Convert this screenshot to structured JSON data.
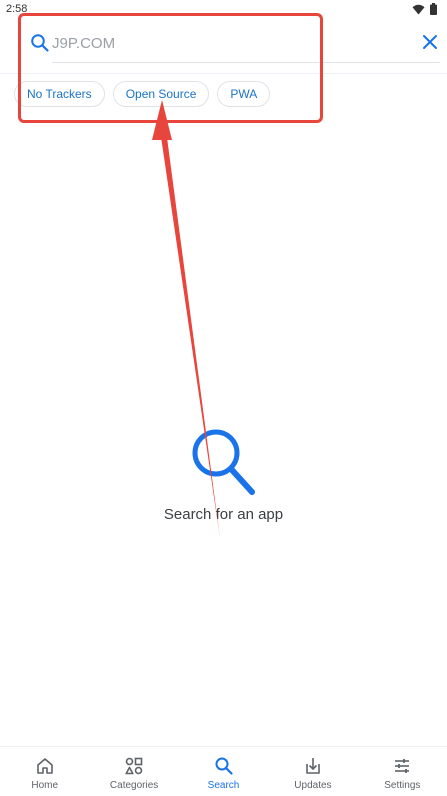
{
  "status_bar": {
    "time": "2:58",
    "icons": [
      "wifi-icon",
      "battery-icon"
    ]
  },
  "search": {
    "value": "",
    "placeholder": "J9P.COM",
    "icon": "search-icon",
    "clear_icon": "close-icon"
  },
  "chips": [
    {
      "label": "No Trackers"
    },
    {
      "label": "Open Source"
    },
    {
      "label": "PWA"
    }
  ],
  "empty_state": {
    "icon": "search-icon",
    "text": "Search for an app"
  },
  "bottom_nav": {
    "active": "Search",
    "items": [
      {
        "label": "Home",
        "icon": "home-icon"
      },
      {
        "label": "Categories",
        "icon": "categories-icon"
      },
      {
        "label": "Search",
        "icon": "search-icon"
      },
      {
        "label": "Updates",
        "icon": "download-icon"
      },
      {
        "label": "Settings",
        "icon": "sliders-icon"
      }
    ]
  },
  "colors": {
    "accent": "#1a73e8",
    "annotation": "#e8453c",
    "inactive": "#5f6368"
  }
}
